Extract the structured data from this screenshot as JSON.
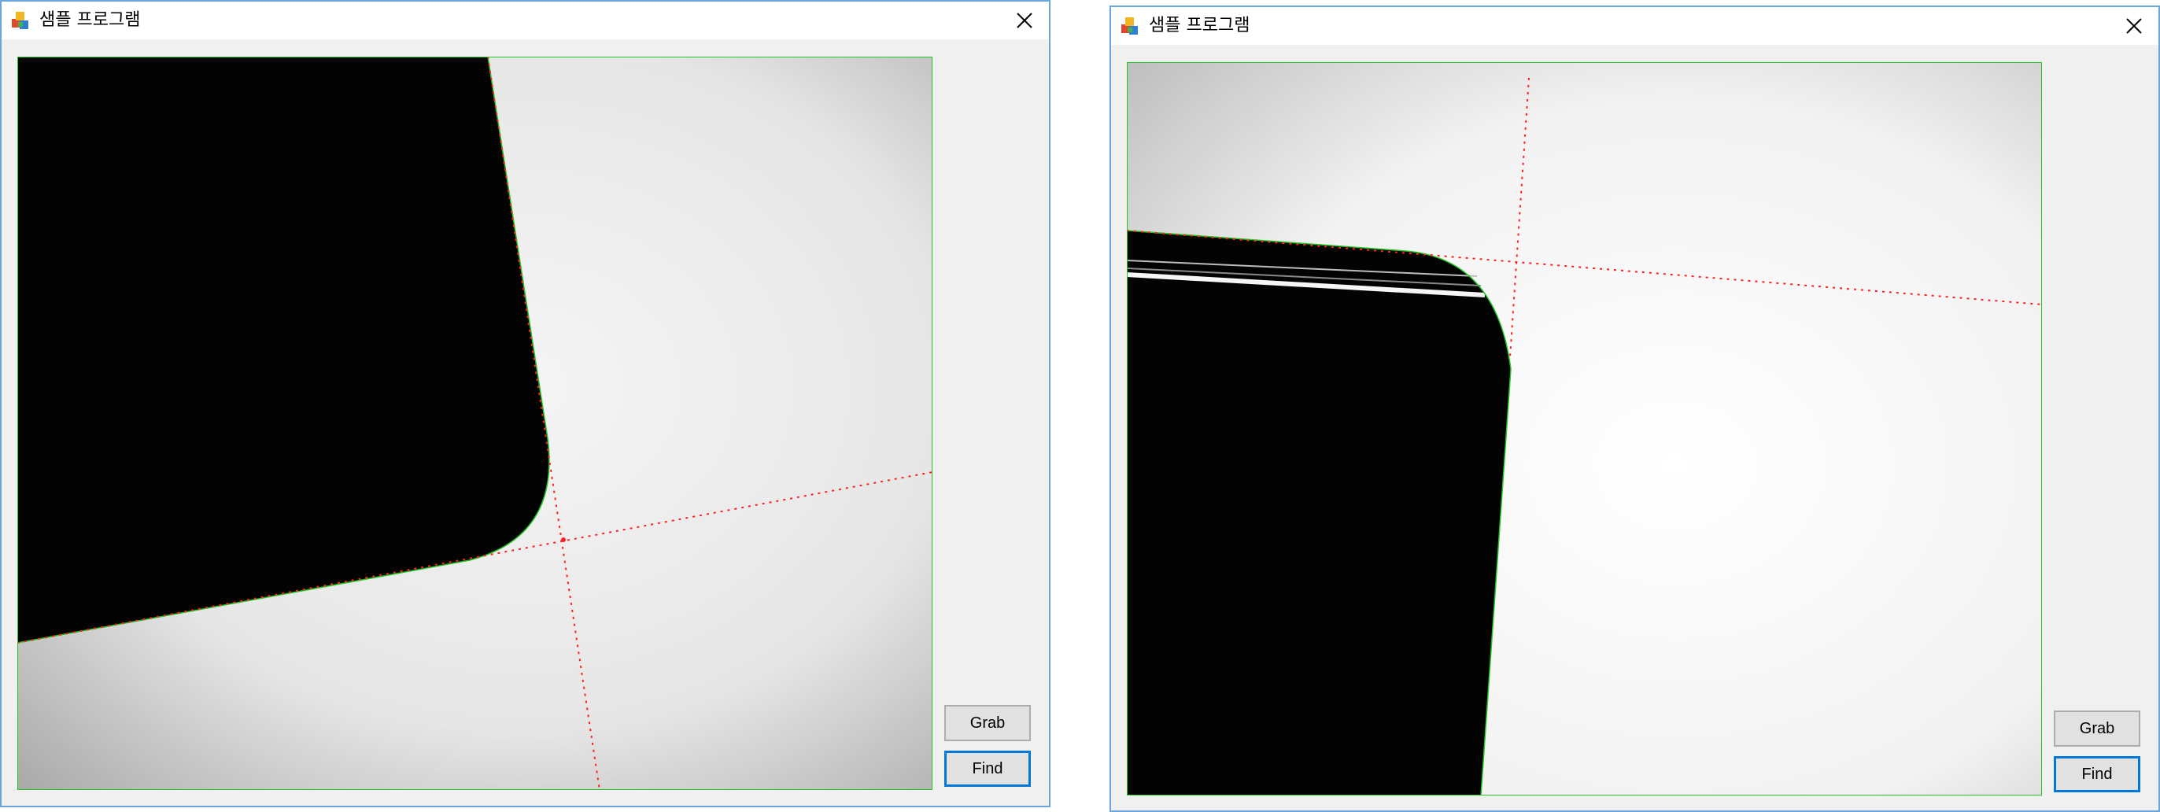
{
  "windows": [
    {
      "title": "샘플 프로그램",
      "buttons": {
        "grab": "Grab",
        "find": "Find"
      }
    },
    {
      "title": "샘플 프로그램",
      "buttons": {
        "grab": "Grab",
        "find": "Find"
      }
    }
  ],
  "icons": {
    "app": "app-cubes-icon",
    "close": "close-icon"
  },
  "colors": {
    "accent": "#0078d7",
    "window_border": "#6aa6de",
    "detected_edge": "#22c622",
    "fit_line": "#ff2020"
  }
}
